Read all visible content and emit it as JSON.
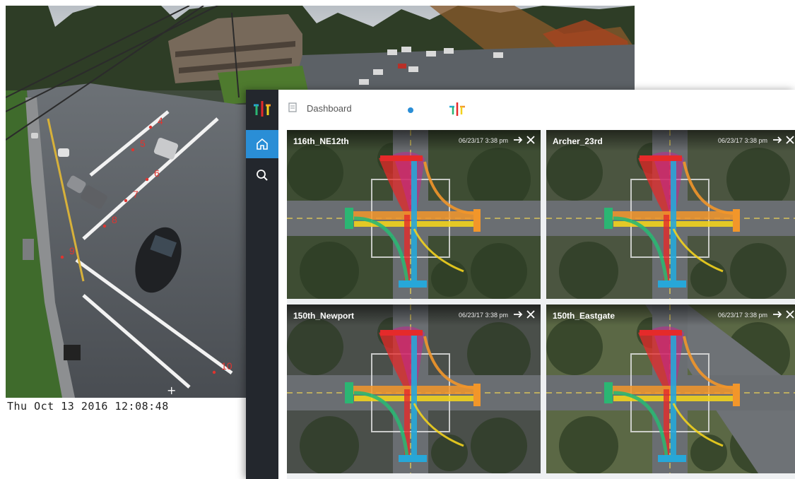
{
  "camera": {
    "timestamp": "Thu Oct 13 2016 12:08:48",
    "markers": [
      "4",
      "5",
      "6",
      "7",
      "8",
      "9",
      "10"
    ]
  },
  "sidebar": {
    "logo_icon": "flow-logo-icon",
    "items": [
      {
        "icon": "home-icon",
        "active": true
      },
      {
        "icon": "search-icon",
        "active": false
      }
    ]
  },
  "header": {
    "page_icon": "document-icon",
    "title": "Dashboard",
    "brand_icon": "flow-logo-icon"
  },
  "tiles": [
    {
      "name": "116th_NE12th",
      "time": "06/23/17 3:38 pm"
    },
    {
      "name": "Archer_23rd",
      "time": "06/23/17 3:38 pm"
    },
    {
      "name": "150th_Newport",
      "time": "06/23/17 3:38 pm"
    },
    {
      "name": "150th_Eastgate",
      "time": "06/23/17 3:38 pm"
    }
  ],
  "colors": {
    "accent": "#2a8ed6",
    "rail": "#23272d",
    "flow_red": "#e52a2a",
    "flow_orange": "#f2962a",
    "flow_yellow": "#f2d21e",
    "flow_green": "#2bb673",
    "flow_blue": "#27a7d8",
    "flow_magenta": "#c2278f",
    "marker": "#e0342f"
  }
}
